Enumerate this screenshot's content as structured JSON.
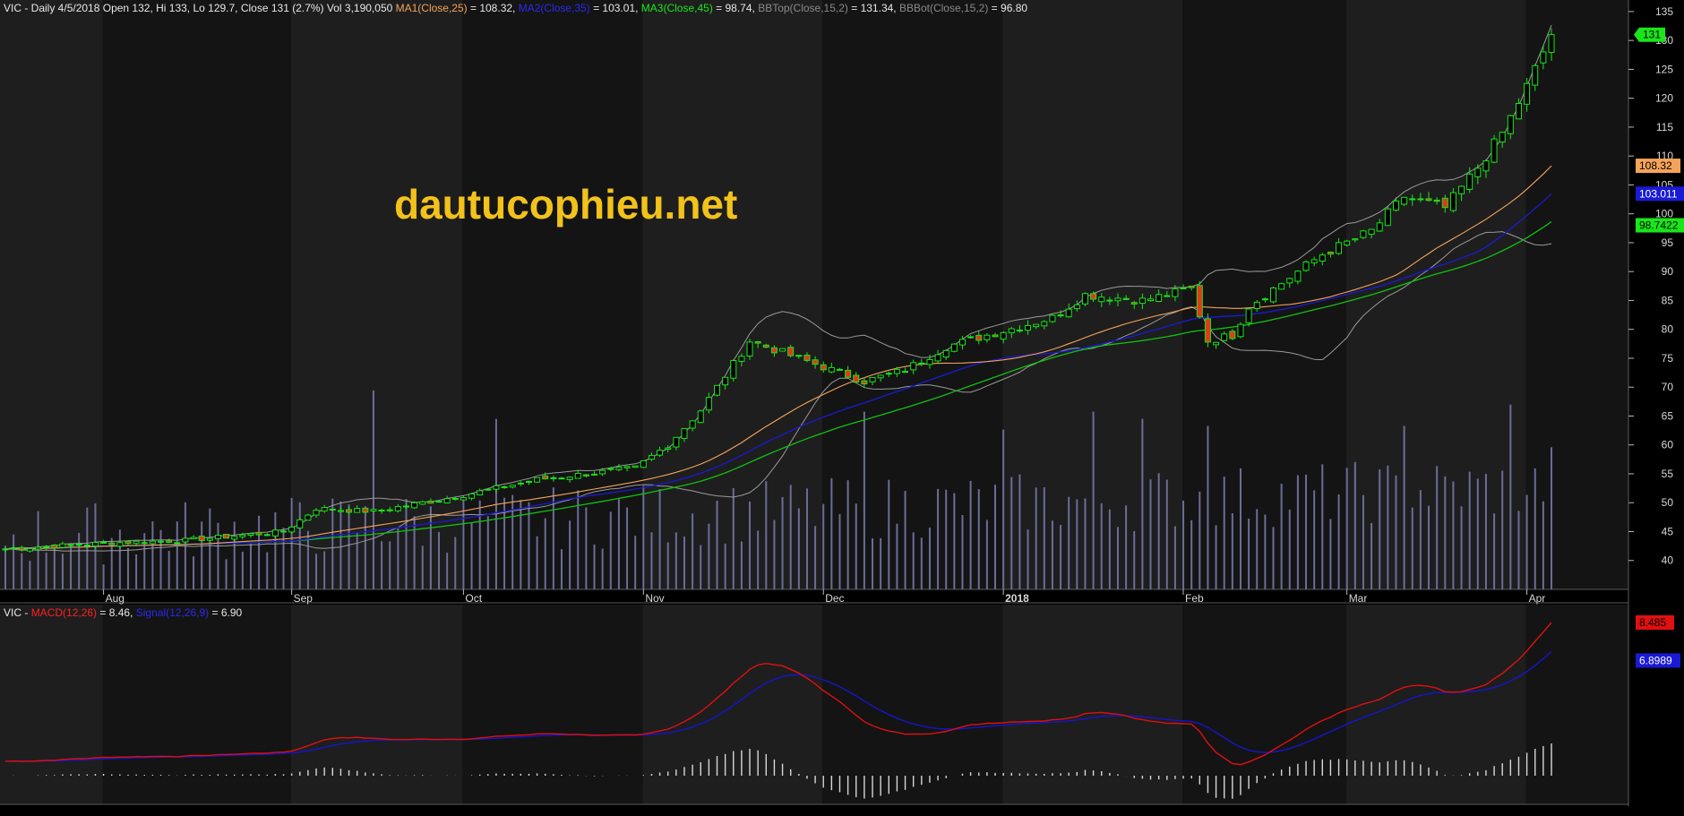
{
  "header": {
    "ticker": "VIC",
    "info": " - Daily 4/5/2018 Open 132, Hi 133, Lo 129.7, Close 131 (2.7%) Vol 3,190,050 ",
    "ma1_label": "MA1(Close,25)",
    "ma1_value": " = 108.32, ",
    "ma2_label": "MA2(Close,35)",
    "ma2_value": " = 103.01, ",
    "ma3_label": "MA3(Close,45)",
    "ma3_value": " = 98.74, ",
    "bbtop_label": "BBTop(Close,15,2)",
    "bbtop_value": " = 131.34, ",
    "bbbot_label": "BBBot(Close,15,2)",
    "bbbot_value": " = 96.80"
  },
  "macd_header": {
    "ticker": "VIC",
    "sep": " - ",
    "macd_label": "MACD(12,26)",
    "macd_value": " = 8.46, ",
    "signal_label": "Signal(12,26,9)",
    "signal_value": " = 6.90"
  },
  "watermark": "dautucophieu.net",
  "colors": {
    "background": "#000000",
    "panel_dark": "#141414",
    "panel_light": "#1e1e1e",
    "up_candle": "#19e619",
    "down_candle": "#e03a1a",
    "ma1": "#f5a35a",
    "ma2": "#1a1ad6",
    "ma3": "#12c012",
    "bollinger": "#9a9a9a",
    "volume": "#6c6c9a",
    "macd": "#e01010",
    "signal": "#1515d0",
    "histogram": "#d8d8d8",
    "watermark": "#f2c21b"
  },
  "price_tags": {
    "last": "131",
    "ma1": "108.32",
    "ma2": "103.011",
    "ma3": "98.7422"
  },
  "macd_tags": {
    "macd": "8.485",
    "signal": "6.8989"
  },
  "chart_data": [
    {
      "type": "candlestick",
      "title": "VIC - Daily",
      "y_ticks": [
        40,
        45,
        50,
        55,
        60,
        65,
        70,
        75,
        80,
        85,
        90,
        95,
        100,
        105,
        110,
        115,
        120,
        125,
        130,
        135
      ],
      "ylim": [
        35,
        137
      ],
      "x_month_labels": [
        "Aug",
        "Sep",
        "Oct",
        "Nov",
        "Dec",
        "2018",
        "Feb",
        "Mar",
        "Apr"
      ],
      "x_month_dates": [
        "2017-08-01",
        "2017-09-01",
        "2017-10-02",
        "2017-11-01",
        "2017-12-01",
        "2018-01-02",
        "2018-02-01",
        "2018-03-01",
        "2018-04-02"
      ],
      "date_range": [
        "2017-07-14",
        "2018-04-05"
      ],
      "grid": true,
      "legend": "top-left",
      "last_close": 131,
      "close_anchors": [
        [
          "2017-07-14",
          42
        ],
        [
          "2017-08-01",
          43
        ],
        [
          "2017-08-15",
          43.5
        ],
        [
          "2017-08-31",
          45
        ],
        [
          "2017-09-06",
          49
        ],
        [
          "2017-09-15",
          48.5
        ],
        [
          "2017-09-29",
          51
        ],
        [
          "2017-10-13",
          54
        ],
        [
          "2017-10-31",
          56
        ],
        [
          "2017-11-06",
          60
        ],
        [
          "2017-11-10",
          66
        ],
        [
          "2017-11-20",
          78
        ],
        [
          "2017-11-30",
          74
        ],
        [
          "2017-12-08",
          71
        ],
        [
          "2017-12-15",
          73
        ],
        [
          "2017-12-22",
          77
        ],
        [
          "2017-12-29",
          79
        ],
        [
          "2018-01-10",
          82
        ],
        [
          "2018-01-16",
          86
        ],
        [
          "2018-01-25",
          85
        ],
        [
          "2018-02-02",
          87
        ],
        [
          "2018-02-06",
          78
        ],
        [
          "2018-02-09",
          79
        ],
        [
          "2018-02-13",
          84
        ],
        [
          "2018-02-26",
          93
        ],
        [
          "2018-03-06",
          97
        ],
        [
          "2018-03-12",
          103
        ],
        [
          "2018-03-19",
          101
        ],
        [
          "2018-03-23",
          108
        ],
        [
          "2018-03-28",
          114
        ],
        [
          "2018-04-02",
          122
        ],
        [
          "2018-04-05",
          131
        ]
      ],
      "series": [
        {
          "name": "MA1(Close,25)",
          "last": 108.32
        },
        {
          "name": "MA2(Close,35)",
          "last": 103.01
        },
        {
          "name": "MA3(Close,45)",
          "last": 98.74
        },
        {
          "name": "BBTop(Close,15,2)",
          "last": 131.34
        },
        {
          "name": "BBBot(Close,15,2)",
          "last": 96.8
        }
      ],
      "volume_spikes": [
        [
          "2017-09-15",
          56
        ],
        [
          "2017-10-06",
          48
        ],
        [
          "2017-12-08",
          50
        ],
        [
          "2018-01-02",
          45
        ],
        [
          "2018-01-17",
          50
        ],
        [
          "2018-01-25",
          48
        ],
        [
          "2018-02-06",
          46
        ],
        [
          "2018-03-12",
          46
        ],
        [
          "2018-03-29",
          52
        ],
        [
          "2018-04-05",
          40
        ]
      ]
    },
    {
      "type": "line",
      "title": "VIC - MACD",
      "series": [
        {
          "name": "MACD(12,26)",
          "last": 8.46
        },
        {
          "name": "Signal(12,26,9)",
          "last": 6.9
        }
      ]
    }
  ]
}
